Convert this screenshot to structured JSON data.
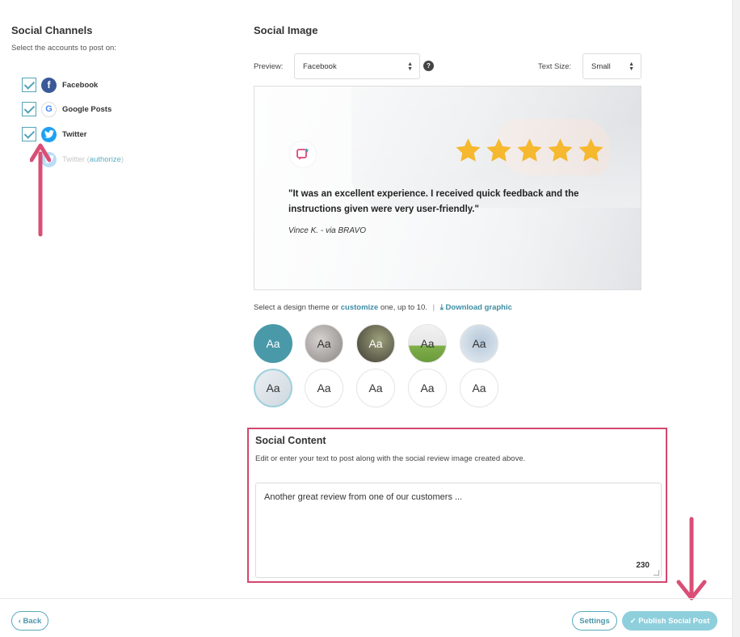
{
  "social_channels": {
    "title": "Social Channels",
    "subtitle": "Select the accounts to post on:",
    "items": [
      {
        "label": "Facebook",
        "checked": true,
        "icon": "facebook-icon"
      },
      {
        "label": "Google Posts",
        "checked": true,
        "icon": "google-icon"
      },
      {
        "label": "Twitter",
        "checked": true,
        "icon": "twitter-icon"
      },
      {
        "label": "Twitter (",
        "link": "authorize",
        "suffix": ")",
        "checked": false,
        "icon": "twitter-icon"
      }
    ]
  },
  "social_image": {
    "title": "Social Image",
    "preview_label": "Preview:",
    "preview_value": "Facebook",
    "help": "?",
    "text_size_label": "Text Size:",
    "text_size_value": "Small",
    "quote": "\"It was an excellent experience. I received quick feedback and the instructions given were very user-friendly.\"",
    "author": "Vince K. - via BRAVO",
    "rating_stars": 5
  },
  "themes": {
    "line_prefix": "Select a design theme or",
    "customize": "customize",
    "line_suffix": "one, up to 10.",
    "separator": "|",
    "download": "Download graphic",
    "items": [
      {
        "label": "Aa"
      },
      {
        "label": "Aa"
      },
      {
        "label": "Aa"
      },
      {
        "label": "Aa"
      },
      {
        "label": "Aa"
      },
      {
        "label": "Aa"
      },
      {
        "label": "Aa"
      },
      {
        "label": "Aa"
      },
      {
        "label": "Aa"
      },
      {
        "label": "Aa"
      }
    ]
  },
  "social_content": {
    "title": "Social Content",
    "desc": "Edit or enter your text to post along with the social review image created above.",
    "text": "Another great review from one of our customers ...",
    "char_count": "230"
  },
  "footer": {
    "back": "‹ Back",
    "settings": "Settings",
    "publish": "✓ Publish Social Post"
  },
  "colors": {
    "accent": "#4a99a9",
    "highlight_border": "#d3466d",
    "annotation_arrow": "#d94f76",
    "star": "#f5b82e"
  }
}
